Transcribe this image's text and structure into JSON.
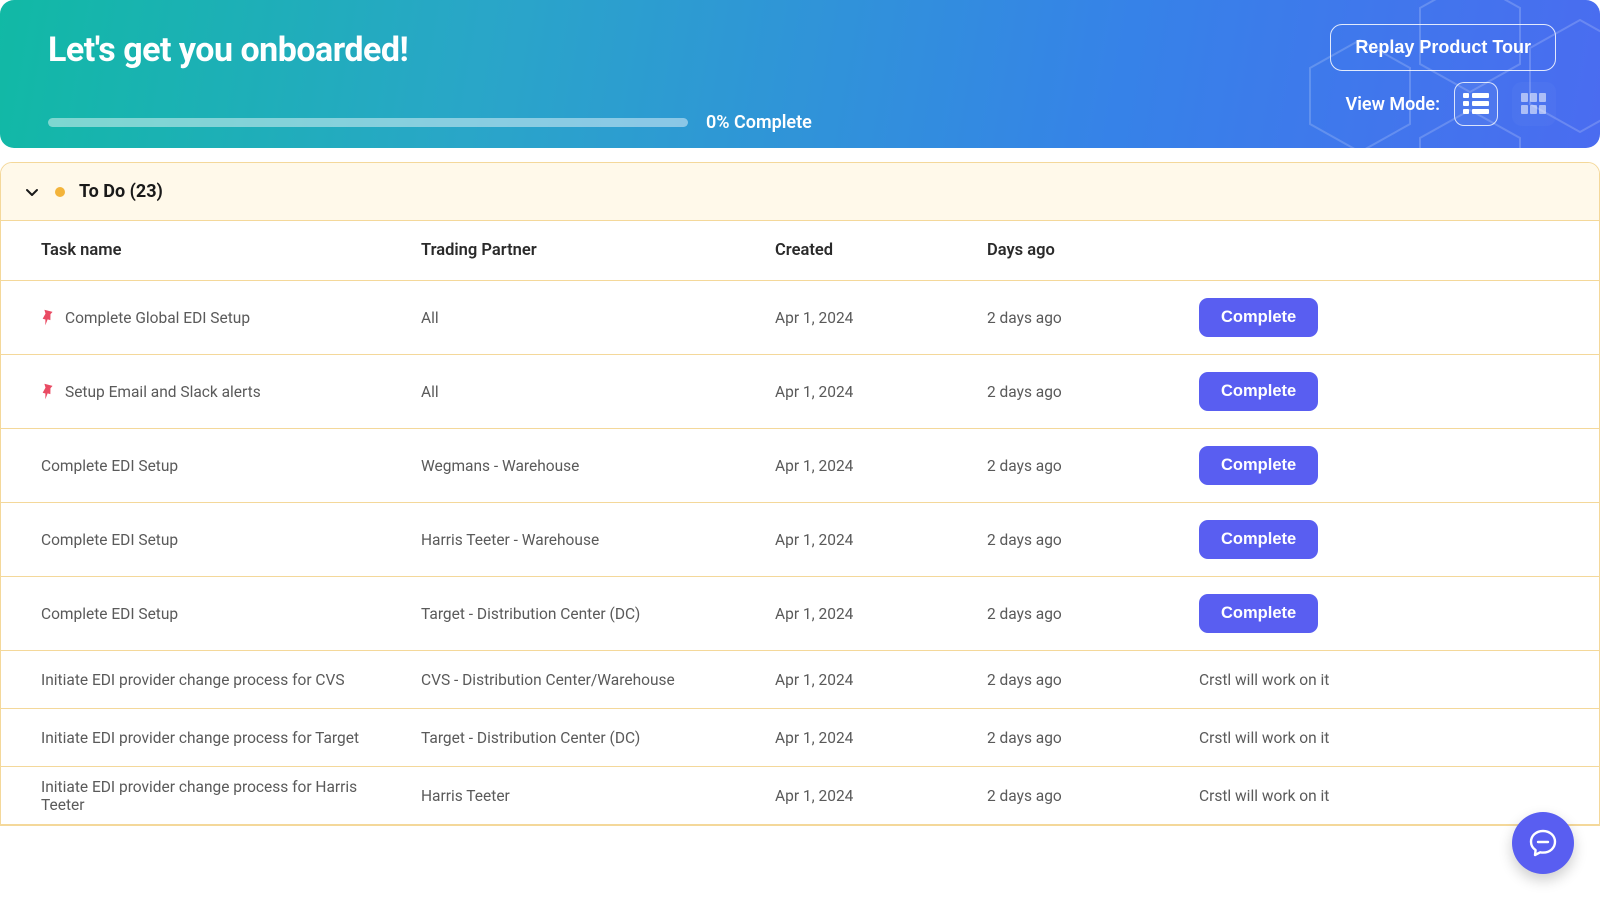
{
  "hero": {
    "title": "Let's get you onboarded!",
    "progress_pct": 0,
    "progress_label": "0% Complete",
    "replay_button": "Replay Product Tour",
    "view_mode_label": "View Mode:"
  },
  "section": {
    "title_base": "To Do",
    "count": 23,
    "title": "To Do (23)"
  },
  "columns": {
    "task": "Task name",
    "partner": "Trading Partner",
    "created": "Created",
    "days_ago": "Days ago"
  },
  "actions": {
    "complete": "Complete",
    "crstl_note": "Crstl will work on it"
  },
  "tasks": [
    {
      "pinned": true,
      "name": "Complete Global EDI Setup",
      "partner": "All",
      "created": "Apr 1, 2024",
      "days_ago": "2 days ago",
      "action": "complete"
    },
    {
      "pinned": true,
      "name": "Setup Email and Slack alerts",
      "partner": "All",
      "created": "Apr 1, 2024",
      "days_ago": "2 days ago",
      "action": "complete"
    },
    {
      "pinned": false,
      "name": "Complete EDI Setup",
      "partner": "Wegmans - Warehouse",
      "created": "Apr 1, 2024",
      "days_ago": "2 days ago",
      "action": "complete"
    },
    {
      "pinned": false,
      "name": "Complete EDI Setup",
      "partner": "Harris Teeter - Warehouse",
      "created": "Apr 1, 2024",
      "days_ago": "2 days ago",
      "action": "complete"
    },
    {
      "pinned": false,
      "name": "Complete EDI Setup",
      "partner": "Target - Distribution Center (DC)",
      "created": "Apr 1, 2024",
      "days_ago": "2 days ago",
      "action": "complete"
    },
    {
      "pinned": false,
      "name": "Initiate EDI provider change process for CVS",
      "partner": "CVS - Distribution Center/Warehouse",
      "created": "Apr 1, 2024",
      "days_ago": "2 days ago",
      "action": "note"
    },
    {
      "pinned": false,
      "name": "Initiate EDI provider change process for Target",
      "partner": "Target - Distribution Center (DC)",
      "created": "Apr 1, 2024",
      "days_ago": "2 days ago",
      "action": "note"
    },
    {
      "pinned": false,
      "name": "Initiate EDI provider change process for Harris Teeter",
      "partner": "Harris Teeter",
      "created": "Apr 1, 2024",
      "days_ago": "2 days ago",
      "action": "note"
    }
  ]
}
